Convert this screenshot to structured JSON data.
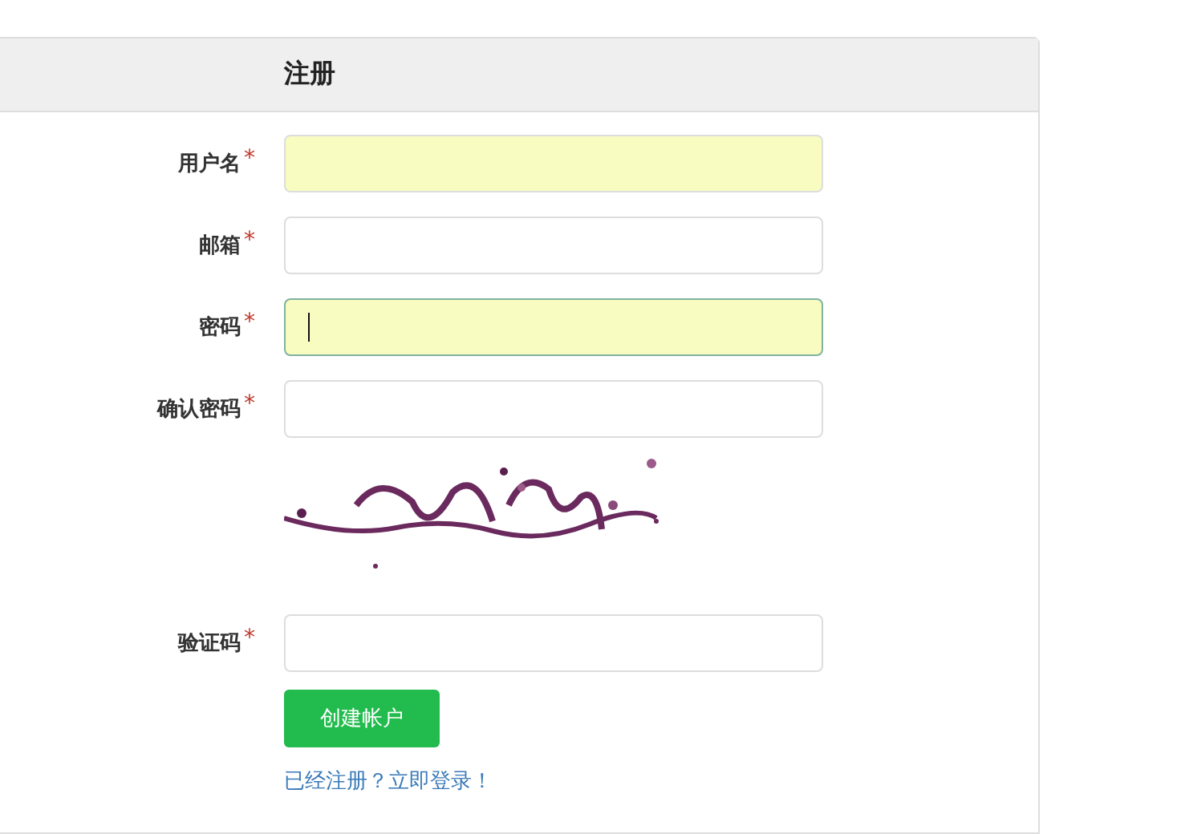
{
  "panel": {
    "title": "注册"
  },
  "fields": [
    {
      "kind": "input",
      "label": "用户名",
      "required": "*",
      "autofilled": true,
      "focused": false
    },
    {
      "kind": "input",
      "label": "邮箱",
      "required": "*",
      "autofilled": false,
      "focused": false
    },
    {
      "kind": "input",
      "label": "密码",
      "required": "*",
      "autofilled": true,
      "focused": true
    },
    {
      "kind": "input",
      "label": "确认密码",
      "required": "*",
      "autofilled": false,
      "focused": false
    },
    {
      "kind": "picture"
    },
    {
      "kind": "input",
      "label": "验证码",
      "required": "*",
      "autofilled": false,
      "focused": false
    }
  ],
  "submit": {
    "label": "创建帐户"
  },
  "login_link": "已经注册？立即登录！"
}
